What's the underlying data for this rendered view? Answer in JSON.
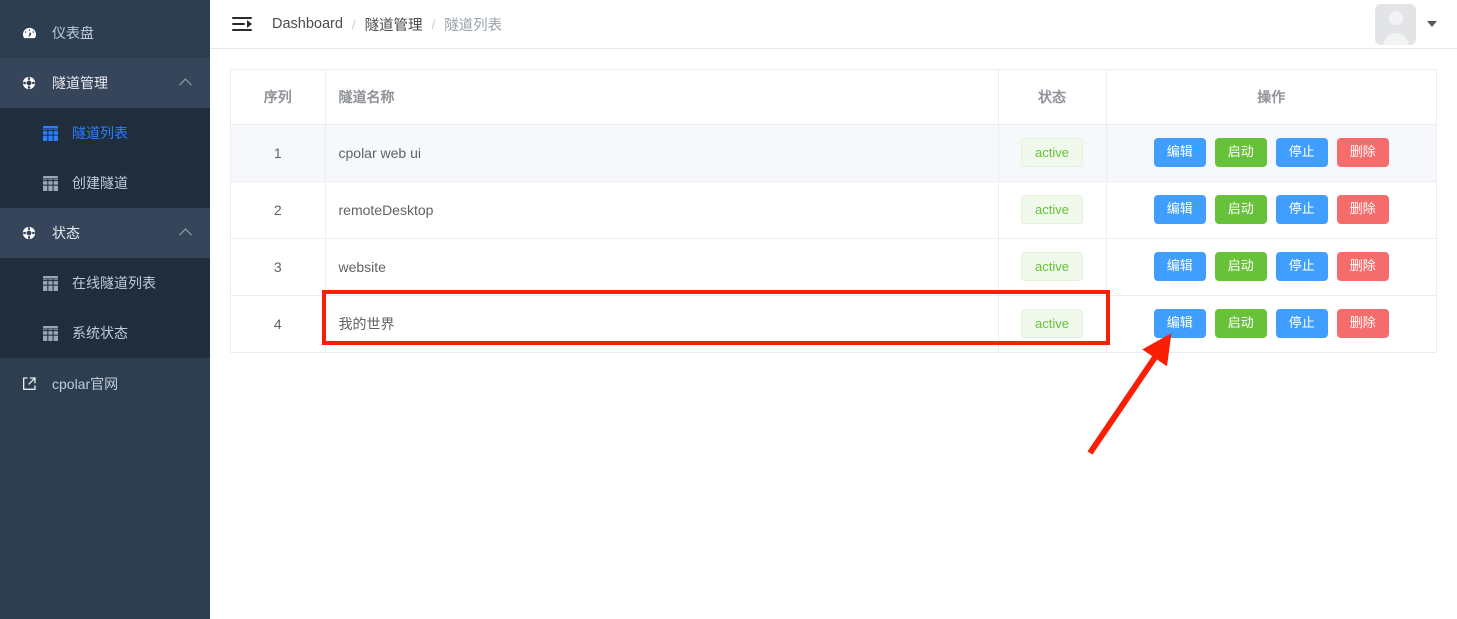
{
  "sidebar": {
    "items": [
      {
        "id": "dashboard",
        "label": "仪表盘",
        "icon": "gauge-icon"
      },
      {
        "id": "tunnel-mgmt",
        "label": "隧道管理",
        "icon": "lifebuoy-icon"
      },
      {
        "id": "tunnel-list",
        "label": "隧道列表",
        "icon": "table-icon"
      },
      {
        "id": "create-tunnel",
        "label": "创建隧道",
        "icon": "table-icon"
      },
      {
        "id": "status",
        "label": "状态",
        "icon": "lifebuoy-icon"
      },
      {
        "id": "online-tunnel-list",
        "label": "在线隧道列表",
        "icon": "table-icon"
      },
      {
        "id": "system-status",
        "label": "系统状态",
        "icon": "table-icon"
      },
      {
        "id": "cpolar-site",
        "label": "cpolar官网",
        "icon": "external-link-icon"
      }
    ],
    "active_item": "隧道列表"
  },
  "topbar": {
    "menu_toggle_icon": "hamburger-collapse-icon",
    "breadcrumb": [
      {
        "label": "Dashboard",
        "current": false
      },
      {
        "label": "隧道管理",
        "current": false
      },
      {
        "label": "隧道列表",
        "current": true
      }
    ],
    "breadcrumb_separator": "/",
    "avatar_icon": "user-avatar-placeholder",
    "avatar_caret_icon": "caret-down-icon"
  },
  "table": {
    "headers": [
      "序列",
      "隧道名称",
      "状态",
      "操作"
    ],
    "rows": [
      {
        "index": "1",
        "name": "cpolar web ui",
        "status": "active"
      },
      {
        "index": "2",
        "name": "remoteDesktop",
        "status": "active"
      },
      {
        "index": "3",
        "name": "website",
        "status": "active"
      },
      {
        "index": "4",
        "name": "我的世界",
        "status": "active"
      }
    ],
    "actions": {
      "edit": "编辑",
      "start": "启动",
      "stop": "停止",
      "delete": "删除"
    }
  },
  "colors": {
    "sidebar_bg": "#2d3e50",
    "submenu_bg": "#1f2d3d",
    "active_nav": "#2b7fff",
    "btn_primary": "#409eff",
    "btn_success": "#67c23a",
    "btn_danger": "#f56c6c",
    "badge_text": "#67c23a",
    "badge_bg": "#f0f9eb",
    "annotation": "#f81f05"
  }
}
